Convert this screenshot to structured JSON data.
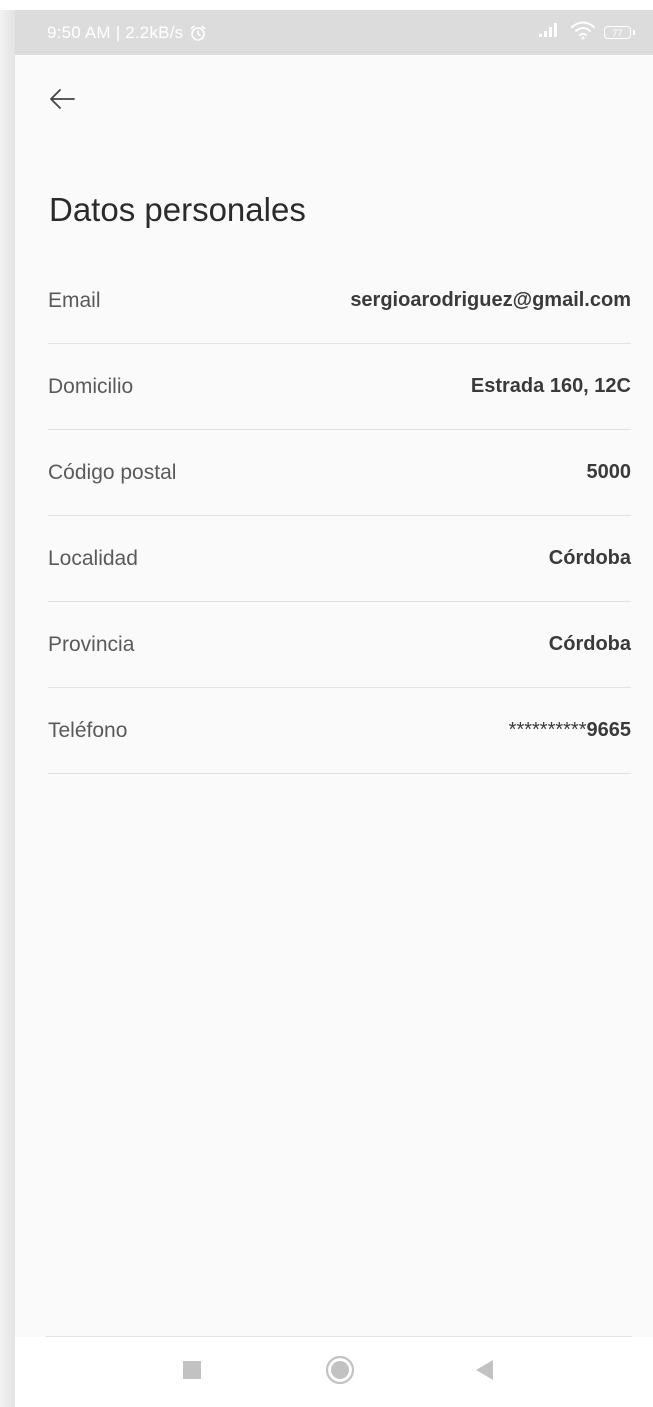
{
  "status_bar": {
    "time_speed": "9:50 AM | 2.2kB/s",
    "battery_level": "77"
  },
  "header": {
    "title": "Datos personales"
  },
  "fields": [
    {
      "label": "Email",
      "value": "sergioarodriguez@gmail.com"
    },
    {
      "label": "Domicilio",
      "value": "Estrada 160, 12C"
    },
    {
      "label": "Código postal",
      "value": "5000"
    },
    {
      "label": "Localidad",
      "value": "Córdoba"
    },
    {
      "label": "Provincia",
      "value": "Córdoba"
    },
    {
      "label": "Teléfono",
      "value_mask": "**********",
      "value_tail": "9665"
    }
  ],
  "icons": {
    "back": "arrow-left-icon",
    "alarm": "alarm-clock-icon",
    "signal": "signal-bars-icon",
    "wifi": "wifi-icon",
    "battery": "battery-icon",
    "nav_recents": "square-icon",
    "nav_home": "circle-icon",
    "nav_back": "triangle-back-icon"
  },
  "colors": {
    "status_bar_bg": "#dcdcdc",
    "page_bg": "#fafafa",
    "title_text": "#2b2b2b",
    "label_text": "#5a5a5a",
    "value_text": "#3a3a3a",
    "divider": "#e3e3e3",
    "nav_icons": "#c2c2c2"
  }
}
